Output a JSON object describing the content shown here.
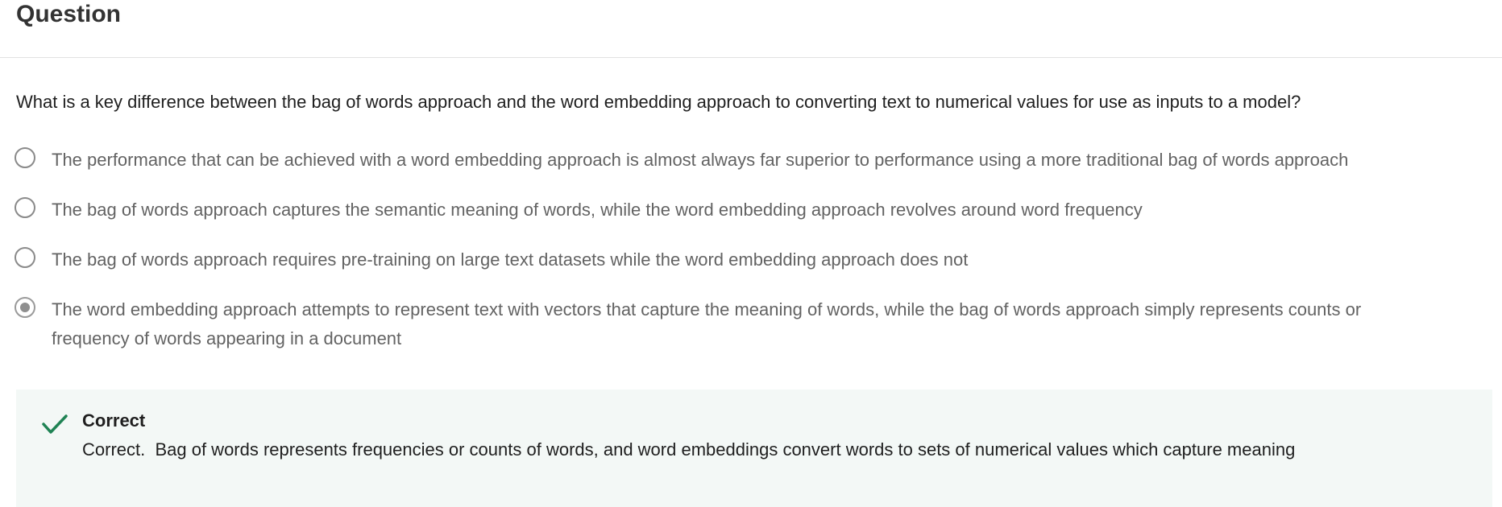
{
  "header": {
    "title": "Question"
  },
  "question": {
    "text": "What is a key difference between the bag of words approach and the word embedding approach to converting text to numerical values for use as inputs to a model?"
  },
  "options": [
    {
      "label": "The performance that can be achieved with a word embedding approach is almost always far superior to performance using a more traditional bag of words approach",
      "selected": false
    },
    {
      "label": "The bag of words approach captures the semantic meaning of words, while the word embedding approach revolves around word frequency",
      "selected": false
    },
    {
      "label": "The bag of words approach requires pre-training on large text datasets while the word embedding approach does not",
      "selected": false
    },
    {
      "label": "The word embedding approach attempts to represent text with vectors that capture the meaning of words, while the bag of words approach simply represents counts or frequency of words appearing in a document",
      "selected": true
    }
  ],
  "feedback": {
    "icon": "checkmark-icon",
    "title": "Correct",
    "text": "Correct.  Bag of words represents frequencies or counts of words, and word embeddings convert words to sets of numerical values which capture meaning",
    "colors": {
      "background": "#f3f8f6",
      "check": "#1f8354"
    }
  }
}
